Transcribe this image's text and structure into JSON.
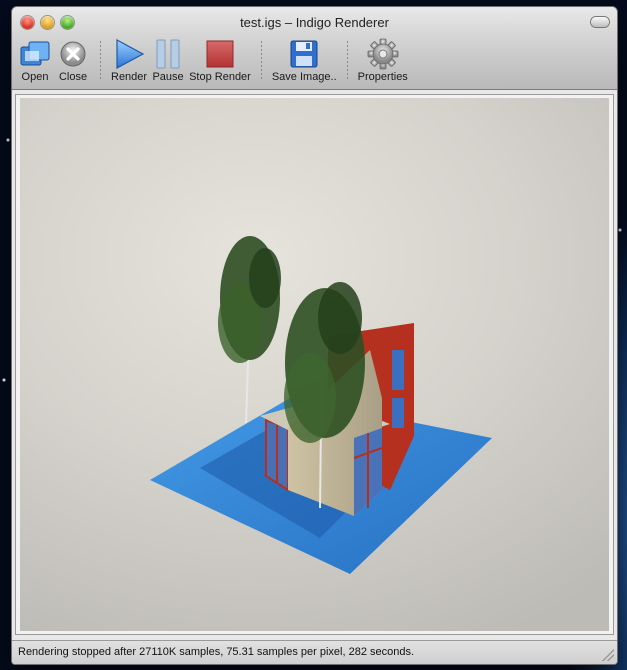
{
  "window": {
    "title": "test.igs – Indigo Renderer"
  },
  "toolbar": {
    "open": {
      "label": "Open",
      "icon": "open-folder-icon"
    },
    "close": {
      "label": "Close",
      "icon": "close-circle-icon"
    },
    "render": {
      "label": "Render",
      "icon": "play-icon"
    },
    "pause": {
      "label": "Pause",
      "icon": "pause-icon"
    },
    "stop": {
      "label": "Stop Render",
      "icon": "stop-icon"
    },
    "save": {
      "label": "Save Image..",
      "icon": "floppy-disk-icon"
    },
    "properties": {
      "label": "Properties",
      "icon": "gear-icon"
    }
  },
  "status": {
    "text": "Rendering stopped after 27110K samples, 75.31 samples per pixel, 282 seconds."
  },
  "colors": {
    "accent_blue": "#2f7fd8",
    "stop_red": "#c0393b",
    "ground_blue": "#2d86dc",
    "wall_red": "#b6301f"
  }
}
